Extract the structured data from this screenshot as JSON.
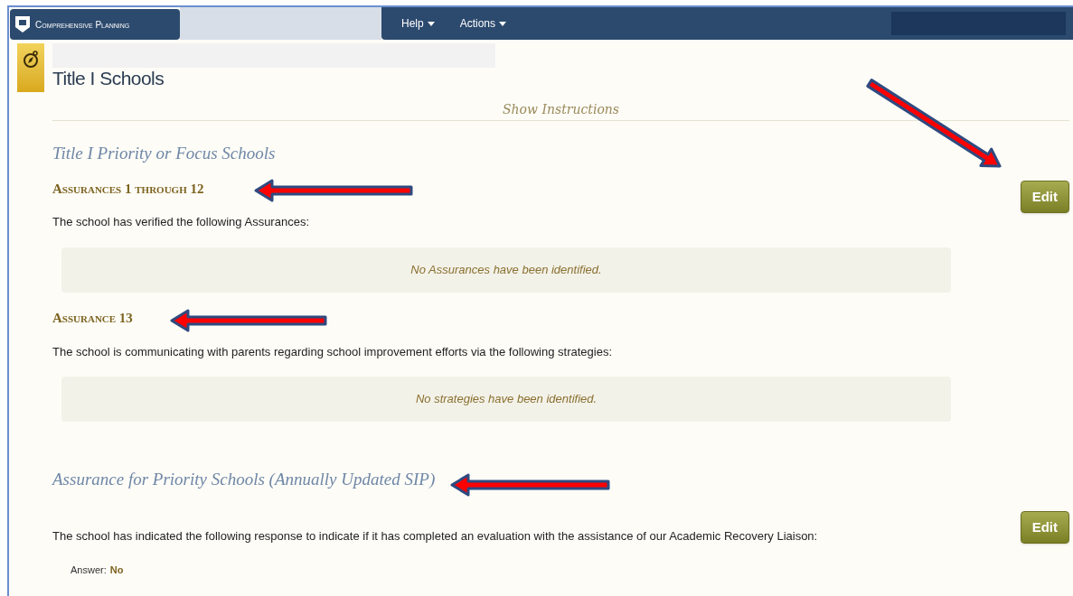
{
  "header": {
    "app_name": "Comprehensive Planning",
    "menus": [
      {
        "label": "Help"
      },
      {
        "label": "Actions"
      }
    ]
  },
  "page": {
    "title": "Title I Schools",
    "instructions_link": "Show Instructions"
  },
  "sections": [
    {
      "heading": "Title I Priority or Focus Schools",
      "edit_label": "Edit",
      "items": [
        {
          "kind": "list",
          "subheading": "Assurances 1 through 12",
          "text": "The school has verified the following Assurances:",
          "empty": "No Assurances have been identified."
        },
        {
          "kind": "list",
          "subheading": "Assurance 13",
          "text": "The school is communicating with parents regarding school improvement efforts via the following strategies:",
          "empty": "No strategies have been identified."
        }
      ]
    },
    {
      "heading": "Assurance for Priority Schools (Annually Updated SIP)",
      "edit_label": "Edit",
      "items": [
        {
          "kind": "answer",
          "text": "The school has indicated the following response to indicate if it has completed an evaluation with the assistance of our Academic Recovery Liaison:",
          "answer_label": "Answer:",
          "answer": "No"
        }
      ]
    }
  ]
}
